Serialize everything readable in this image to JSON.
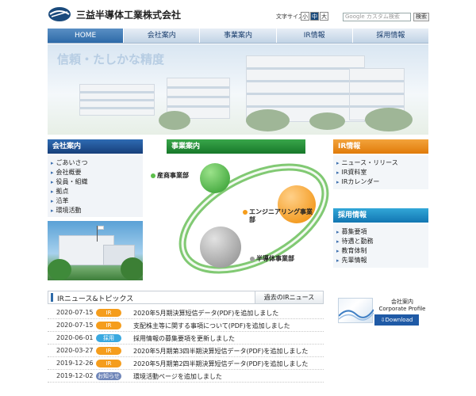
{
  "header": {
    "company_name": "三益半導体工業株式会社",
    "font_size_label": "文字サイズ",
    "font_sizes": [
      "小",
      "中",
      "大"
    ],
    "search_placeholder": "Google カスタム検索",
    "search_button": "検索"
  },
  "nav": [
    "HOME",
    "会社案内",
    "事業案内",
    "IR情報",
    "採用情報"
  ],
  "hero": {
    "title": "信頼・たしかな精度"
  },
  "company": {
    "title": "会社案内",
    "items": [
      "ごあいさつ",
      "会社概要",
      "役員・組織",
      "拠点",
      "沿革",
      "環境活動"
    ]
  },
  "business": {
    "title": "事業案内",
    "divisions": [
      "産商事業部",
      "エンジニアリング事業部",
      "半導体事業部"
    ],
    "colors": {
      "sansho": "#5cbf4a",
      "engineering": "#f59d1c",
      "semiconductor": "#9e9e9e"
    }
  },
  "ir": {
    "title": "IR情報",
    "items": [
      "ニュース・リリース",
      "IR資料室",
      "IRカレンダー"
    ]
  },
  "recruit": {
    "title": "採用情報",
    "items": [
      "募集要項",
      "待遇と勤務",
      "教育体制",
      "先輩情報"
    ]
  },
  "news": {
    "title": "IRニュース&トピックス",
    "archive_link": "過去のIRニュース",
    "items": [
      {
        "date": "2020-07-15",
        "category": "IR",
        "text": "2020年5月期決算短信データ(PDF)を追加しました",
        "color": "#f59d1c"
      },
      {
        "date": "2020-07-15",
        "category": "IR",
        "text": "支配株主等に関する事項について(PDF)を追加しました",
        "color": "#f59d1c"
      },
      {
        "date": "2020-06-01",
        "category": "採用",
        "text": "採用情報の募集要項を更新しました",
        "color": "#3aa9e0"
      },
      {
        "date": "2020-03-27",
        "category": "IR",
        "text": "2020年5月期第3四半期決算短信データ(PDF)を追加しました",
        "color": "#f59d1c"
      },
      {
        "date": "2019-12-26",
        "category": "IR",
        "text": "2020年5月期第2四半期決算短信データ(PDF)を追加しました",
        "color": "#f59d1c"
      },
      {
        "date": "2019-12-02",
        "category": "お知らせ",
        "text": "環境活動ページを追加しました",
        "color": "#6f86b9"
      }
    ]
  },
  "profile": {
    "title_ja": "会社案内",
    "title_en": "Corporate Profile",
    "download": "Download PDF"
  }
}
